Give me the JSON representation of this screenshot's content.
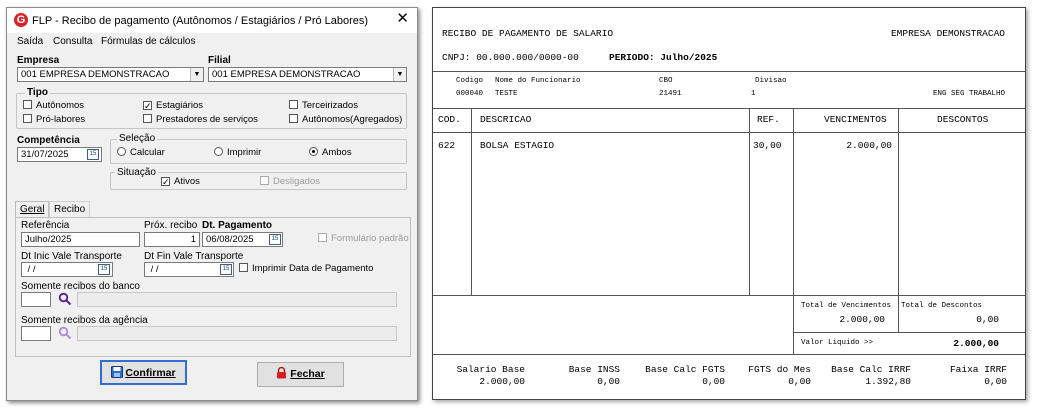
{
  "dialog": {
    "title": "FLP - Recibo de pagamento (Autônomos / Estagiários / Pró Labores)",
    "close_glyph": "✕",
    "menu": [
      "Saída",
      "Consulta",
      "Fórmulas de cálculos"
    ],
    "empresa_label": "Empresa",
    "empresa_value": "001 EMPRESA DEMONSTRACAO",
    "filial_label": "Filial",
    "filial_value": "001 EMPRESA DEMONSTRACAO",
    "tipo_label": "Tipo",
    "tipo_options": [
      {
        "label": "Autônomos",
        "checked": false
      },
      {
        "label": "Estagiários",
        "checked": true
      },
      {
        "label": "Terceirizados",
        "checked": false
      },
      {
        "label": "Pró-labores",
        "checked": false
      },
      {
        "label": "Prestadores de serviços",
        "checked": false
      },
      {
        "label": "Autônomos(Agregados)",
        "checked": false
      }
    ],
    "competencia_label": "Competência",
    "competencia_value": "31/07/2025",
    "selecao_label": "Seleção",
    "selecao_options": [
      {
        "label": "Calcular",
        "selected": false
      },
      {
        "label": "Imprimir",
        "selected": false
      },
      {
        "label": "Ambos",
        "selected": true
      }
    ],
    "situacao_label": "Situação",
    "situacao_ativos": "Ativos",
    "situacao_desligados": "Desligados",
    "tabs": [
      "Geral",
      "Recibo"
    ],
    "referencia_label": "Referência",
    "referencia_value": "Julho/2025",
    "prox_recibo_label": "Próx. recibo",
    "prox_recibo_value": "1",
    "dt_pagamento_label": "Dt. Pagamento",
    "dt_pagamento_value": "06/08/2025",
    "formulario_padrao": "Formulário padrão",
    "dt_inic_vt_label": "Dt Inic Vale Transporte",
    "dt_inic_vt_value": " / /",
    "dt_fin_vt_label": "Dt Fin Vale Transporte",
    "dt_fin_vt_value": " / /",
    "imprimir_data_pagamento": "Imprimir Data de Pagamento",
    "somente_banco_label": "Somente recibos do banco",
    "somente_agencia_label": "Somente recibos da agência",
    "confirmar_label": "Confirmar",
    "fechar_label": "Fechar",
    "calendar_glyph": "15"
  },
  "report": {
    "title": "RECIBO DE PAGAMENTO DE SALARIO",
    "company": "EMPRESA DEMONSTRACAO",
    "cnpj": "CNPJ: 00.000.000/0000-00",
    "periodo": "PERIODO: Julho/2025",
    "emp_headers": {
      "codigo": "Codigo",
      "nome": "Nome do Funcionario",
      "cbo": "CBO",
      "divisao": "Divisao"
    },
    "emp_values": {
      "codigo": "000040",
      "nome": "TESTE",
      "cbo": "21491",
      "divisao": "1",
      "setor": "ENG SEG TRABALHO"
    },
    "col_headers": {
      "cod": "COD.",
      "descricao": "DESCRICAO",
      "ref": "REF.",
      "vencimentos": "VENCIMENTOS",
      "descontos": "DESCONTOS"
    },
    "items": [
      {
        "cod": "622",
        "descricao": "BOLSA ESTAGIO",
        "ref": "30,00",
        "vencimentos": "2.000,00",
        "descontos": ""
      }
    ],
    "totals": {
      "total_venc_label": "Total de Vencimentos",
      "total_venc_value": "2.000,00",
      "total_desc_label": "Total de Descontos",
      "total_desc_value": "0,00",
      "liquido_label": "Valor Liquido >>",
      "liquido_value": "2.000,00"
    },
    "footer": [
      {
        "label": "Salario Base",
        "value": "2.000,00"
      },
      {
        "label": "Base INSS",
        "value": "0,00"
      },
      {
        "label": "Base Calc FGTS",
        "value": "0,00"
      },
      {
        "label": "FGTS do Mes",
        "value": "0,00"
      },
      {
        "label": "Base Calc IRRF",
        "value": "1.392,80"
      },
      {
        "label": "Faixa IRRF",
        "value": "0,00"
      }
    ]
  }
}
